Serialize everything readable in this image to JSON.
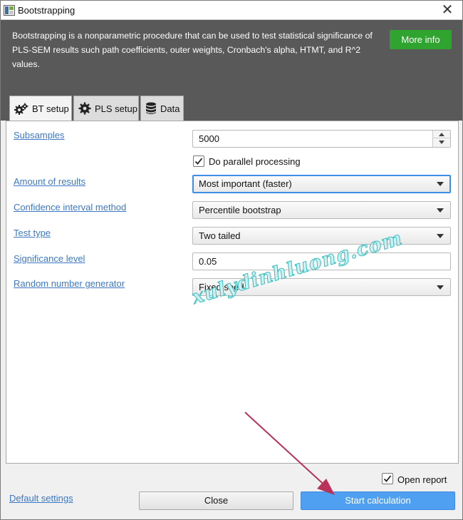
{
  "window": {
    "title": "Bootstrapping",
    "close_glyph": "✕"
  },
  "header": {
    "description": "Bootstrapping is a nonparametric procedure that can be used to test statistical significance of PLS-SEM results such path coefficients, outer weights, Cronbach's alpha, HTMT, and R^2 values.",
    "more_info_label": "More info",
    "more_info_color": "#2fa530"
  },
  "tabs": [
    {
      "label": "BT setup",
      "icon": "gears-icon",
      "active": true
    },
    {
      "label": "PLS setup",
      "icon": "gear-icon",
      "active": false
    },
    {
      "label": "Data",
      "icon": "database-icon",
      "active": false
    }
  ],
  "form": {
    "subsamples": {
      "label": "Subsamples",
      "value": "5000"
    },
    "parallel": {
      "label": "Do parallel processing",
      "checked": true
    },
    "amount": {
      "label": "Amount of results",
      "value": "Most important (faster)"
    },
    "ci_method": {
      "label": "Confidence interval method",
      "value": "Percentile bootstrap"
    },
    "test_type": {
      "label": "Test type",
      "value": "Two tailed"
    },
    "significance": {
      "label": "Significance level",
      "value": "0.05"
    },
    "rng": {
      "label": "Random number generator",
      "value": "Fixed seed"
    }
  },
  "watermark": "xulydinhluong.com",
  "footer": {
    "open_report": {
      "label": "Open report",
      "checked": true
    },
    "default_settings_label": "Default settings",
    "close_label": "Close",
    "start_label": "Start calculation"
  },
  "colors": {
    "header_bg": "#595959",
    "link": "#3c78c3",
    "primary": "#4fa0f0",
    "annotation_arrow": "#b8325a"
  }
}
